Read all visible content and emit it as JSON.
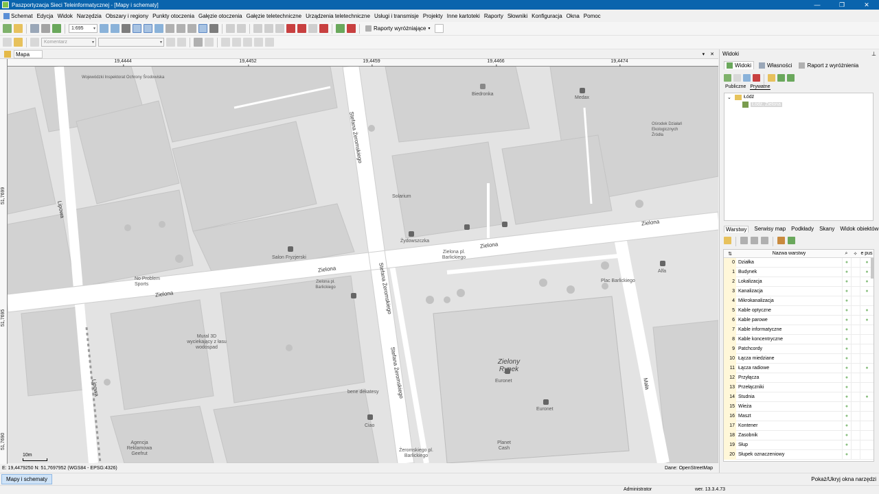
{
  "window": {
    "title": "Paszportyzacja Sieci Teleinformatycznej - [Mapy i schematy]"
  },
  "menu": [
    "Schemat",
    "Edycja",
    "Widok",
    "Narzędzia",
    "Obszary i regiony",
    "Punkty otoczenia",
    "Gałęzie otoczenia",
    "Gałęzie teletechniczne",
    "Urządzenia teletechniczne",
    "Usługi i transmisje",
    "Projekty",
    "Inne kartoteki",
    "Raporty",
    "Słowniki",
    "Konfiguracja",
    "Okna",
    "Pomoc"
  ],
  "toolbar": {
    "scale_value": "1:695",
    "highlight_reports_label": "Raporty wyróżniające",
    "comment_placeholder": "Komentarz"
  },
  "map_tab": {
    "label": "Mapa"
  },
  "ruler": {
    "top_ticks": [
      "19,4444",
      "19,4452",
      "19,4459",
      "19,4466",
      "19,4474"
    ],
    "left_ticks": [
      "51,7699",
      "51,7695",
      "51,7690"
    ]
  },
  "map": {
    "streets": [
      "Stefana Żeromskiego",
      "Stefana Żeromskiego",
      "Stefana Żeromskiego",
      "Zielona",
      "Zielona",
      "Zielona",
      "Zielona",
      "Lipowa",
      "Lipowa",
      "Mała"
    ],
    "labels": [
      "Wojewódzki Inspektorat Ochrony Środowiska",
      "Biedronka",
      "Medax",
      "Ośrodek Działań Ekologicznych Źródła",
      "No Problem Sports",
      "Salon Fryzjerski",
      "Solarium",
      "Zielona pl. Barlickiego",
      "Plac Barlickiego",
      "Alfa",
      "Mural 3D wyciekający z łasu wodospad",
      "bene dekatesy",
      "Ciao",
      "Euronet",
      "Euronet",
      "Planet Cash",
      "Żeromskiego pl. Barlickiego",
      "Agencja Reklamowa Geefrut",
      "Żydowszczka",
      "Zielona pl. Barlickiego"
    ],
    "market_label": "Zielony Rynek",
    "scale_label": "10m"
  },
  "coordbar": {
    "coords": "E: 19,4479250  N: 51,7697952 (WGS84 - EPSG:4326)",
    "source": "Dane: OpenStreetMap"
  },
  "taskbar": {
    "active_window": "Mapy i schematy",
    "toggle_label": "Pokaż/Ukryj okna narzędzi"
  },
  "statusbar": {
    "user": "Administrator",
    "version": "wer. 13.3.4.73"
  },
  "panel": {
    "title": "Widoki",
    "tabs": [
      "Widoki",
      "Własności",
      "Raport z wyróżnienia"
    ],
    "subtabs": [
      "Publiczne",
      "Prywatne"
    ],
    "tree": {
      "root": "Łódź",
      "child": "Łódź, Zielona"
    },
    "layer_tabs": [
      "Warstwy",
      "Serwisy map",
      "Podkłady",
      "Skany",
      "Widok obiektów"
    ],
    "layer_header": {
      "name": "Nazwa warstwy",
      "pus": "e pus"
    },
    "layers": [
      {
        "n": "0",
        "name": "Działka",
        "c2": true,
        "c4": true
      },
      {
        "n": "1",
        "name": "Budynek",
        "c2": true,
        "c4": true
      },
      {
        "n": "2",
        "name": "Lokalizacja",
        "c2": true,
        "c4": true
      },
      {
        "n": "3",
        "name": "Kanalizacja",
        "c2": true,
        "c4": true
      },
      {
        "n": "4",
        "name": "Mikrokanalizacja",
        "c2": true,
        "c4": false
      },
      {
        "n": "5",
        "name": "Kable optyczne",
        "c2": true,
        "c4": true
      },
      {
        "n": "6",
        "name": "Kable parowe",
        "c2": true,
        "c4": true
      },
      {
        "n": "7",
        "name": "Kable informatyczne",
        "c2": true,
        "c4": false
      },
      {
        "n": "8",
        "name": "Kable koncentryczne",
        "c2": true,
        "c4": false
      },
      {
        "n": "9",
        "name": "Patchcordy",
        "c2": true,
        "c4": false
      },
      {
        "n": "10",
        "name": "Łącza miedziane",
        "c2": true,
        "c4": false
      },
      {
        "n": "11",
        "name": "Łącza radiowe",
        "c2": true,
        "c4": true
      },
      {
        "n": "12",
        "name": "Przyłącza",
        "c2": true,
        "c4": false
      },
      {
        "n": "13",
        "name": "Przełączniki",
        "c2": true,
        "c4": false
      },
      {
        "n": "14",
        "name": "Studnia",
        "c2": true,
        "c4": true
      },
      {
        "n": "15",
        "name": "Wieża",
        "c2": true,
        "c4": false
      },
      {
        "n": "16",
        "name": "Maszt",
        "c2": true,
        "c4": false
      },
      {
        "n": "17",
        "name": "Kontener",
        "c2": true,
        "c4": false
      },
      {
        "n": "18",
        "name": "Zasobnik",
        "c2": true,
        "c4": false
      },
      {
        "n": "19",
        "name": "Słup",
        "c2": true,
        "c4": false
      },
      {
        "n": "20",
        "name": "Słupek oznaczeniowy",
        "c2": true,
        "c4": false
      }
    ]
  },
  "colors": {
    "titlebar": "#0a64ad",
    "map_background": "#e3e3e3",
    "buildings": "#d0d0d0",
    "roads": "#ffffff",
    "check": "#8cc082"
  }
}
